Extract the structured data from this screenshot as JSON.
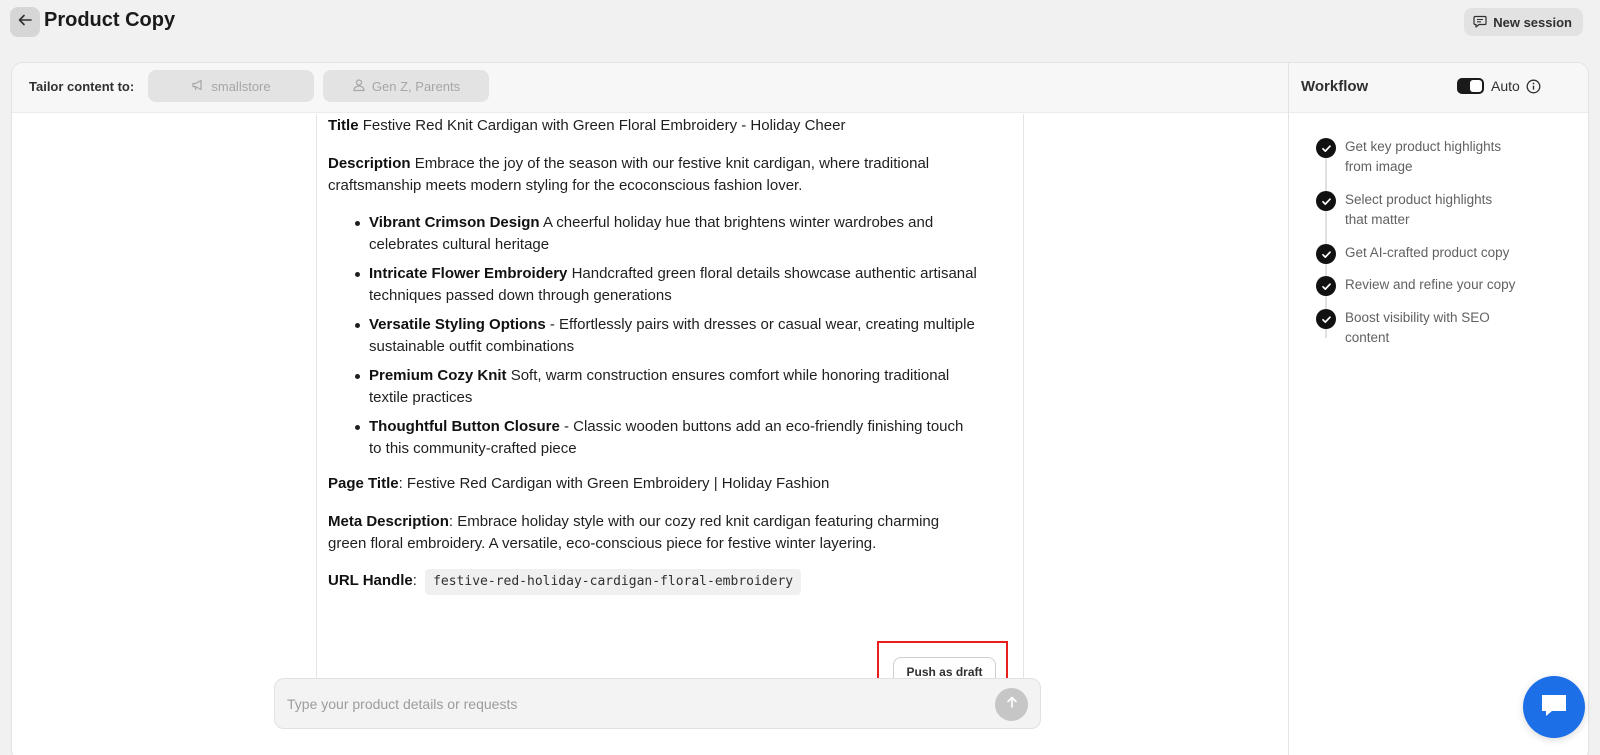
{
  "header": {
    "title": "Product Copy",
    "new_session_label": "New session"
  },
  "tailor": {
    "label": "Tailor content to:",
    "store_chip": "smallstore",
    "audience_chip": "Gen Z, Parents"
  },
  "copy": {
    "title_label": "Title",
    "title_value": "Festive Red Knit Cardigan with Green Floral Embroidery - Holiday Cheer",
    "description_label": "Description",
    "description_line1": "Embrace the joy of the season with our festive knit cardigan, where traditional",
    "description_line2": "craftsmanship meets modern styling for the ecoconscious fashion lover.",
    "bullets": [
      {
        "label": "Vibrant Crimson Design",
        "line1": "A cheerful holiday hue that brightens winter wardrobes and",
        "line2": "celebrates cultural heritage"
      },
      {
        "label": "Intricate Flower Embroidery",
        "line1": "Handcrafted green floral details showcase authentic artisanal",
        "line2": "techniques passed down through generations"
      },
      {
        "label": "Versatile Styling Options",
        "line1": "- Effortlessly pairs with dresses or casual wear, creating multiple",
        "line2": "sustainable outfit combinations"
      },
      {
        "label": "Premium Cozy Knit",
        "line1": "Soft, warm construction ensures comfort while honoring traditional",
        "line2": "textile practices"
      },
      {
        "label": "Thoughtful Button Closure",
        "line1": "- Classic wooden buttons add an eco-friendly finishing touch",
        "line2": "to this community-crafted piece"
      }
    ],
    "page_title_label": "Page Title",
    "page_title_value": ": Festive Red Cardigan with Green Embroidery | Holiday Fashion",
    "meta_label": "Meta Description",
    "meta_line1": ": Embrace holiday style with our cozy red knit cardigan featuring charming",
    "meta_line2": "green floral embroidery. A versatile, eco-conscious piece for festive winter layering.",
    "url_label": "URL Handle",
    "url_sep": ":",
    "url_value": "festive-red-holiday-cardigan-floral-embroidery",
    "push_label": "Push as draft"
  },
  "prompt": {
    "placeholder": "Type your product details or requests"
  },
  "workflow": {
    "title": "Workflow",
    "auto_label": "Auto",
    "auto_enabled": true,
    "steps": [
      {
        "line1": "Get key product highlights",
        "line2": "from image"
      },
      {
        "line1": "Select product highlights",
        "line2": "that matter"
      },
      {
        "line1": "Get AI-crafted product copy",
        "line2": ""
      },
      {
        "line1": "Review and refine your copy",
        "line2": ""
      },
      {
        "line1": "Boost visibility with SEO",
        "line2": "content"
      }
    ]
  },
  "icons": {
    "back": "arrow-left-icon",
    "new_session": "chat-icon",
    "store": "megaphone-icon",
    "audience": "person-icon",
    "send": "arrow-up-icon",
    "info": "info-icon",
    "check": "check-icon",
    "chat_fab": "chat-bubble-icon"
  },
  "colors": {
    "highlight": "#e8201c",
    "chat_fab": "#1d6fe8",
    "check_bg": "#111111"
  }
}
